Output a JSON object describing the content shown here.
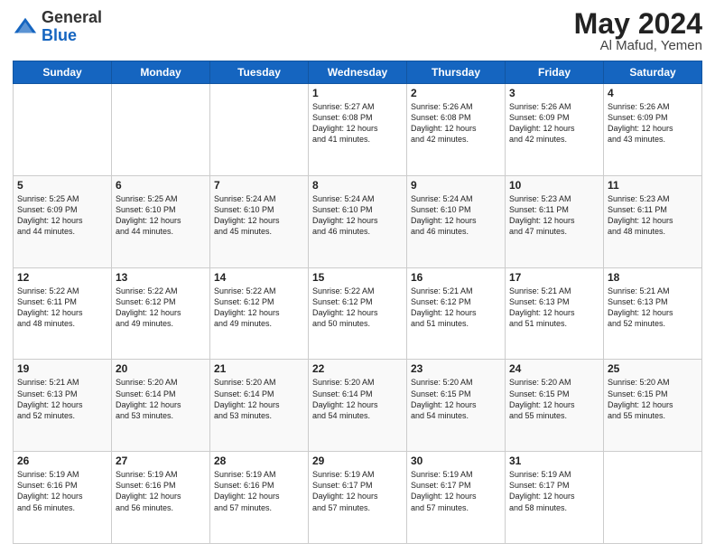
{
  "header": {
    "logo_general": "General",
    "logo_blue": "Blue",
    "title": "May 2024",
    "location": "Al Mafud, Yemen"
  },
  "weekdays": [
    "Sunday",
    "Monday",
    "Tuesday",
    "Wednesday",
    "Thursday",
    "Friday",
    "Saturday"
  ],
  "weeks": [
    [
      {
        "day": "",
        "info": ""
      },
      {
        "day": "",
        "info": ""
      },
      {
        "day": "",
        "info": ""
      },
      {
        "day": "1",
        "info": "Sunrise: 5:27 AM\nSunset: 6:08 PM\nDaylight: 12 hours\nand 41 minutes."
      },
      {
        "day": "2",
        "info": "Sunrise: 5:26 AM\nSunset: 6:08 PM\nDaylight: 12 hours\nand 42 minutes."
      },
      {
        "day": "3",
        "info": "Sunrise: 5:26 AM\nSunset: 6:09 PM\nDaylight: 12 hours\nand 42 minutes."
      },
      {
        "day": "4",
        "info": "Sunrise: 5:26 AM\nSunset: 6:09 PM\nDaylight: 12 hours\nand 43 minutes."
      }
    ],
    [
      {
        "day": "5",
        "info": "Sunrise: 5:25 AM\nSunset: 6:09 PM\nDaylight: 12 hours\nand 44 minutes."
      },
      {
        "day": "6",
        "info": "Sunrise: 5:25 AM\nSunset: 6:10 PM\nDaylight: 12 hours\nand 44 minutes."
      },
      {
        "day": "7",
        "info": "Sunrise: 5:24 AM\nSunset: 6:10 PM\nDaylight: 12 hours\nand 45 minutes."
      },
      {
        "day": "8",
        "info": "Sunrise: 5:24 AM\nSunset: 6:10 PM\nDaylight: 12 hours\nand 46 minutes."
      },
      {
        "day": "9",
        "info": "Sunrise: 5:24 AM\nSunset: 6:10 PM\nDaylight: 12 hours\nand 46 minutes."
      },
      {
        "day": "10",
        "info": "Sunrise: 5:23 AM\nSunset: 6:11 PM\nDaylight: 12 hours\nand 47 minutes."
      },
      {
        "day": "11",
        "info": "Sunrise: 5:23 AM\nSunset: 6:11 PM\nDaylight: 12 hours\nand 48 minutes."
      }
    ],
    [
      {
        "day": "12",
        "info": "Sunrise: 5:22 AM\nSunset: 6:11 PM\nDaylight: 12 hours\nand 48 minutes."
      },
      {
        "day": "13",
        "info": "Sunrise: 5:22 AM\nSunset: 6:12 PM\nDaylight: 12 hours\nand 49 minutes."
      },
      {
        "day": "14",
        "info": "Sunrise: 5:22 AM\nSunset: 6:12 PM\nDaylight: 12 hours\nand 49 minutes."
      },
      {
        "day": "15",
        "info": "Sunrise: 5:22 AM\nSunset: 6:12 PM\nDaylight: 12 hours\nand 50 minutes."
      },
      {
        "day": "16",
        "info": "Sunrise: 5:21 AM\nSunset: 6:12 PM\nDaylight: 12 hours\nand 51 minutes."
      },
      {
        "day": "17",
        "info": "Sunrise: 5:21 AM\nSunset: 6:13 PM\nDaylight: 12 hours\nand 51 minutes."
      },
      {
        "day": "18",
        "info": "Sunrise: 5:21 AM\nSunset: 6:13 PM\nDaylight: 12 hours\nand 52 minutes."
      }
    ],
    [
      {
        "day": "19",
        "info": "Sunrise: 5:21 AM\nSunset: 6:13 PM\nDaylight: 12 hours\nand 52 minutes."
      },
      {
        "day": "20",
        "info": "Sunrise: 5:20 AM\nSunset: 6:14 PM\nDaylight: 12 hours\nand 53 minutes."
      },
      {
        "day": "21",
        "info": "Sunrise: 5:20 AM\nSunset: 6:14 PM\nDaylight: 12 hours\nand 53 minutes."
      },
      {
        "day": "22",
        "info": "Sunrise: 5:20 AM\nSunset: 6:14 PM\nDaylight: 12 hours\nand 54 minutes."
      },
      {
        "day": "23",
        "info": "Sunrise: 5:20 AM\nSunset: 6:15 PM\nDaylight: 12 hours\nand 54 minutes."
      },
      {
        "day": "24",
        "info": "Sunrise: 5:20 AM\nSunset: 6:15 PM\nDaylight: 12 hours\nand 55 minutes."
      },
      {
        "day": "25",
        "info": "Sunrise: 5:20 AM\nSunset: 6:15 PM\nDaylight: 12 hours\nand 55 minutes."
      }
    ],
    [
      {
        "day": "26",
        "info": "Sunrise: 5:19 AM\nSunset: 6:16 PM\nDaylight: 12 hours\nand 56 minutes."
      },
      {
        "day": "27",
        "info": "Sunrise: 5:19 AM\nSunset: 6:16 PM\nDaylight: 12 hours\nand 56 minutes."
      },
      {
        "day": "28",
        "info": "Sunrise: 5:19 AM\nSunset: 6:16 PM\nDaylight: 12 hours\nand 57 minutes."
      },
      {
        "day": "29",
        "info": "Sunrise: 5:19 AM\nSunset: 6:17 PM\nDaylight: 12 hours\nand 57 minutes."
      },
      {
        "day": "30",
        "info": "Sunrise: 5:19 AM\nSunset: 6:17 PM\nDaylight: 12 hours\nand 57 minutes."
      },
      {
        "day": "31",
        "info": "Sunrise: 5:19 AM\nSunset: 6:17 PM\nDaylight: 12 hours\nand 58 minutes."
      },
      {
        "day": "",
        "info": ""
      }
    ]
  ]
}
